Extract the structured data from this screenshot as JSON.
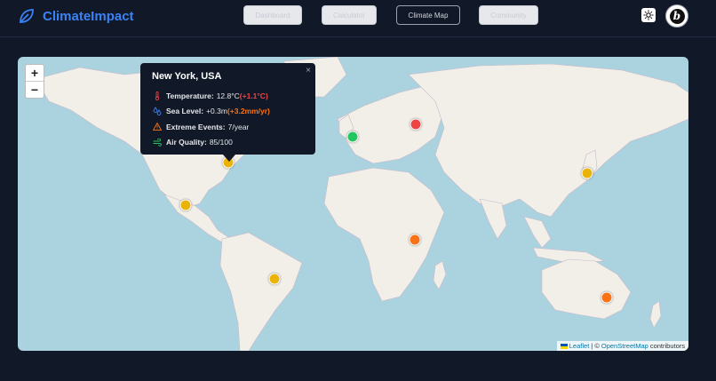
{
  "brand": {
    "name": "ClimateImpact",
    "color": "#3b82f6"
  },
  "nav": [
    {
      "label": "Dashboard",
      "active": false
    },
    {
      "label": "Calculator",
      "active": false
    },
    {
      "label": "Climate Map",
      "active": true
    },
    {
      "label": "Community",
      "active": false
    }
  ],
  "header": {
    "theme_icon": "sun-icon",
    "avatar_letter": "b"
  },
  "map": {
    "zoom_in": "+",
    "zoom_out": "−",
    "attribution": {
      "leaflet": "Leaflet",
      "sep": "| ©",
      "osm": "OpenStreetMap",
      "rest": "contributors"
    },
    "markers": [
      {
        "name": "new-york",
        "color": "#eab308"
      },
      {
        "name": "london",
        "color": "#22c55e"
      },
      {
        "name": "moscow",
        "color": "#ef4444"
      },
      {
        "name": "tokyo",
        "color": "#eab308"
      },
      {
        "name": "mexico-city",
        "color": "#eab308"
      },
      {
        "name": "nairobi",
        "color": "#f97316"
      },
      {
        "name": "sao-paulo",
        "color": "#eab308"
      },
      {
        "name": "sydney",
        "color": "#f97316"
      }
    ]
  },
  "popup": {
    "title": "New York, USA",
    "close": "×",
    "temperature": {
      "label": "Temperature:",
      "value": "12.8°C",
      "change": "(+1.1°C)",
      "color": "#ef4444"
    },
    "sea_level": {
      "label": "Sea Level:",
      "value": "+0.3m",
      "change": "(+3.2mm/yr)",
      "color": "#f97316"
    },
    "extreme_events": {
      "label": "Extreme Events:",
      "value": "7/year"
    },
    "air_quality": {
      "label": "Air Quality:",
      "value": "85/100"
    }
  }
}
